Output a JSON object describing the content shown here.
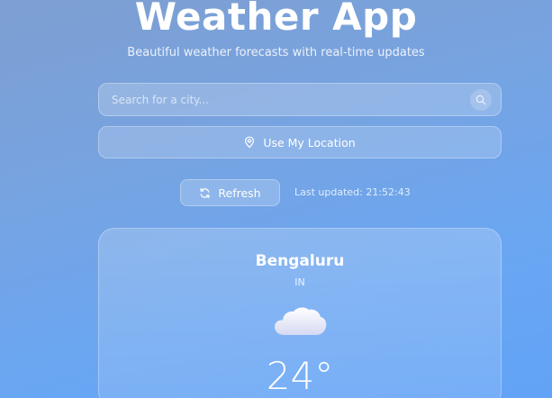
{
  "header": {
    "title": "Weather App",
    "subtitle": "Beautiful weather forecasts with real-time updates"
  },
  "search": {
    "placeholder": "Search for a city...",
    "value": "",
    "button_icon": "search-icon"
  },
  "location_button": {
    "label": "Use My Location",
    "icon": "map-pin-icon"
  },
  "refresh": {
    "label": "Refresh",
    "icon": "refresh-icon",
    "last_updated": "Last updated: 21:52:43"
  },
  "weather": {
    "city": "Bengaluru",
    "country": "IN",
    "icon": "cloud-icon",
    "temperature": "24°"
  },
  "colors": {
    "background_start": "#7e9fd1",
    "background_end": "#62a3f7",
    "text": "#ffffff"
  }
}
